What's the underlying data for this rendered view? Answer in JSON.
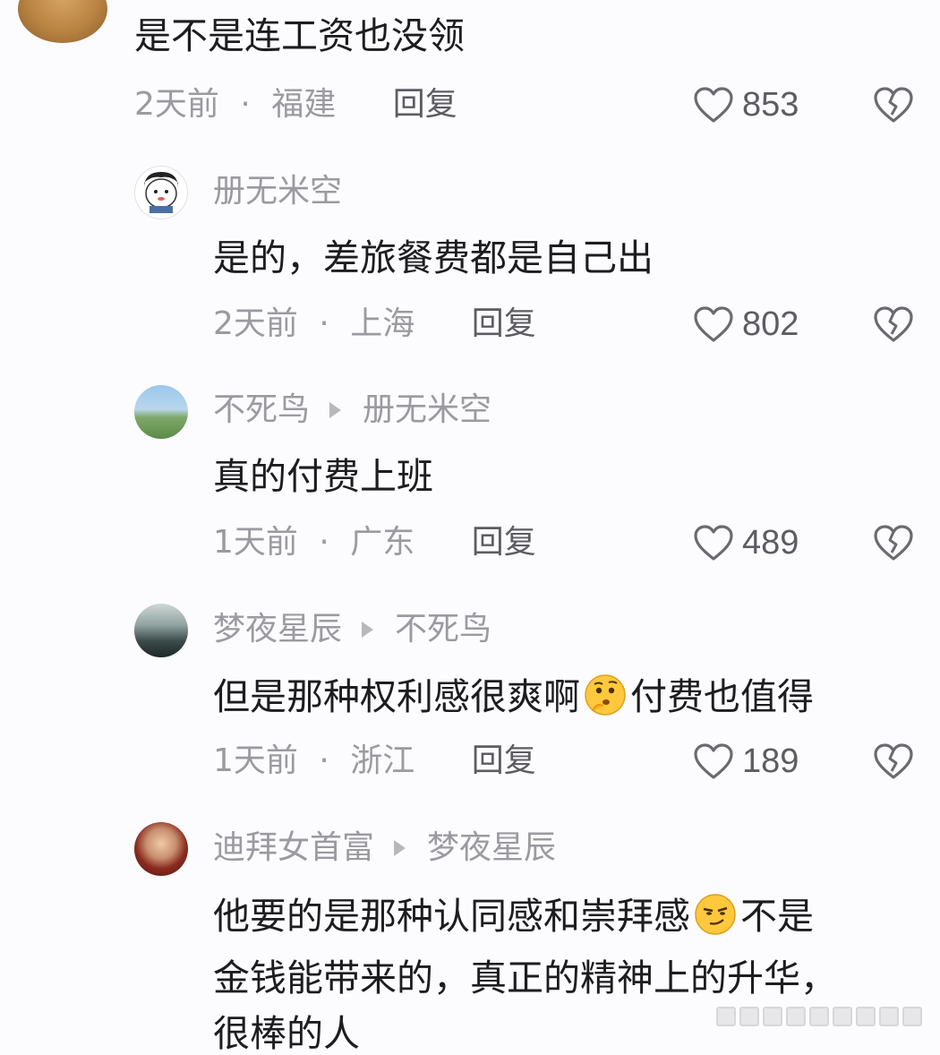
{
  "comments": [
    {
      "text": "是不是连工资也没领",
      "time": "2天前",
      "location": "福建",
      "reply": "回复",
      "likes": "853"
    },
    {
      "user": "册无米空",
      "text": "是的，差旅餐费都是自己出",
      "time": "2天前",
      "location": "上海",
      "reply": "回复",
      "likes": "802"
    },
    {
      "user": "不死鸟",
      "reply_to": "册无米空",
      "text": "真的付费上班",
      "time": "1天前",
      "location": "广东",
      "reply": "回复",
      "likes": "489"
    },
    {
      "user": "梦夜星辰",
      "reply_to": "不死鸟",
      "text_before": "但是那种权利感很爽啊",
      "text_after": "付费也值得",
      "time": "1天前",
      "location": "浙江",
      "reply": "回复",
      "likes": "189"
    },
    {
      "user": "迪拜女首富",
      "reply_to": "梦夜星辰",
      "line1_before": "他要的是那种认同感和崇拜感",
      "line1_after": "不是",
      "line2": "金钱能带来的，真正的精神上的升华，",
      "line3": "很棒的人"
    }
  ],
  "meta_separator": "·",
  "icons": {
    "like": "heart-outline-icon",
    "dislike": "broken-heart-icon",
    "emoji1": "thinking-face-emoji",
    "emoji2": "smirk-face-emoji"
  },
  "colors": {
    "text": "#1d1d1f",
    "meta": "#9a9aa0",
    "reply": "#5c5c62",
    "background": "#fcfcfe"
  }
}
